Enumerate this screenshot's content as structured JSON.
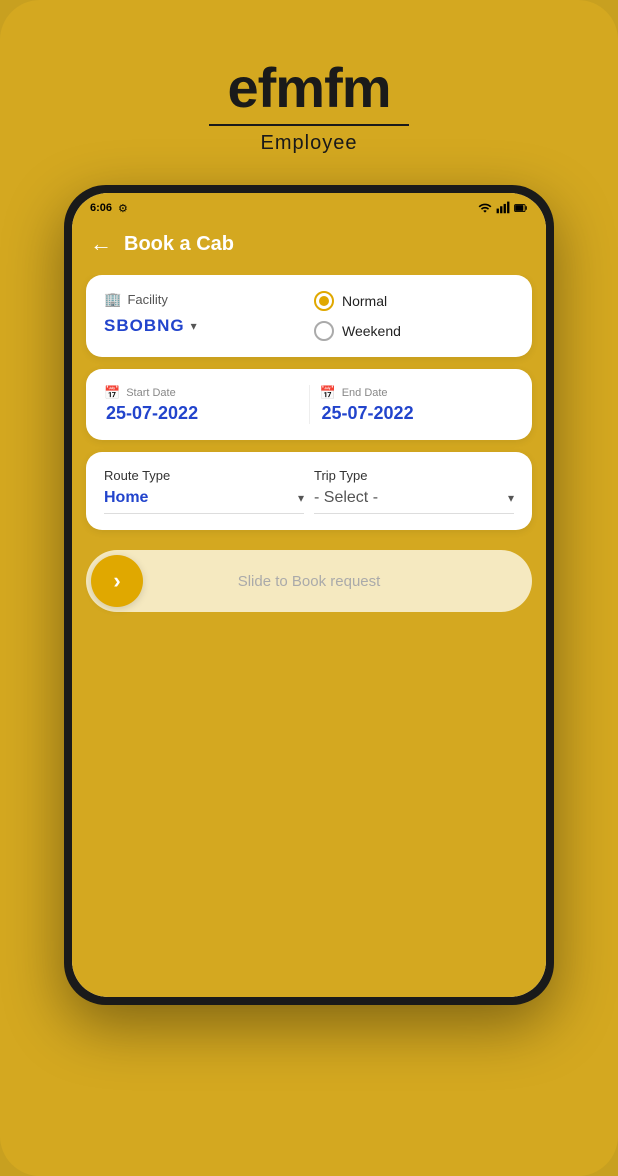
{
  "brand": {
    "name": "efmfm",
    "subtitle": "Employee"
  },
  "status_bar": {
    "time": "6:06",
    "gear": "⚙",
    "wifi": true,
    "signal": true,
    "battery": true
  },
  "header": {
    "back_label": "←",
    "title": "Book a Cab"
  },
  "facility_card": {
    "facility_label": "Facility",
    "facility_value": "SBOBNG",
    "dropdown_arrow": "▾",
    "radio_options": [
      {
        "label": "Normal",
        "selected": true
      },
      {
        "label": "Weekend",
        "selected": false
      }
    ]
  },
  "date_card": {
    "start_label": "Start Date",
    "start_value": "25-07-2022",
    "end_label": "End Date",
    "end_value": "25-07-2022"
  },
  "route_card": {
    "route_type_label": "Route Type",
    "route_type_value": "Home",
    "route_type_arrow": "▾",
    "trip_type_label": "Trip Type",
    "trip_type_value": "- Select -",
    "trip_type_arrow": "▾"
  },
  "slide_button": {
    "arrow": "›",
    "text": "Slide to Book request"
  }
}
